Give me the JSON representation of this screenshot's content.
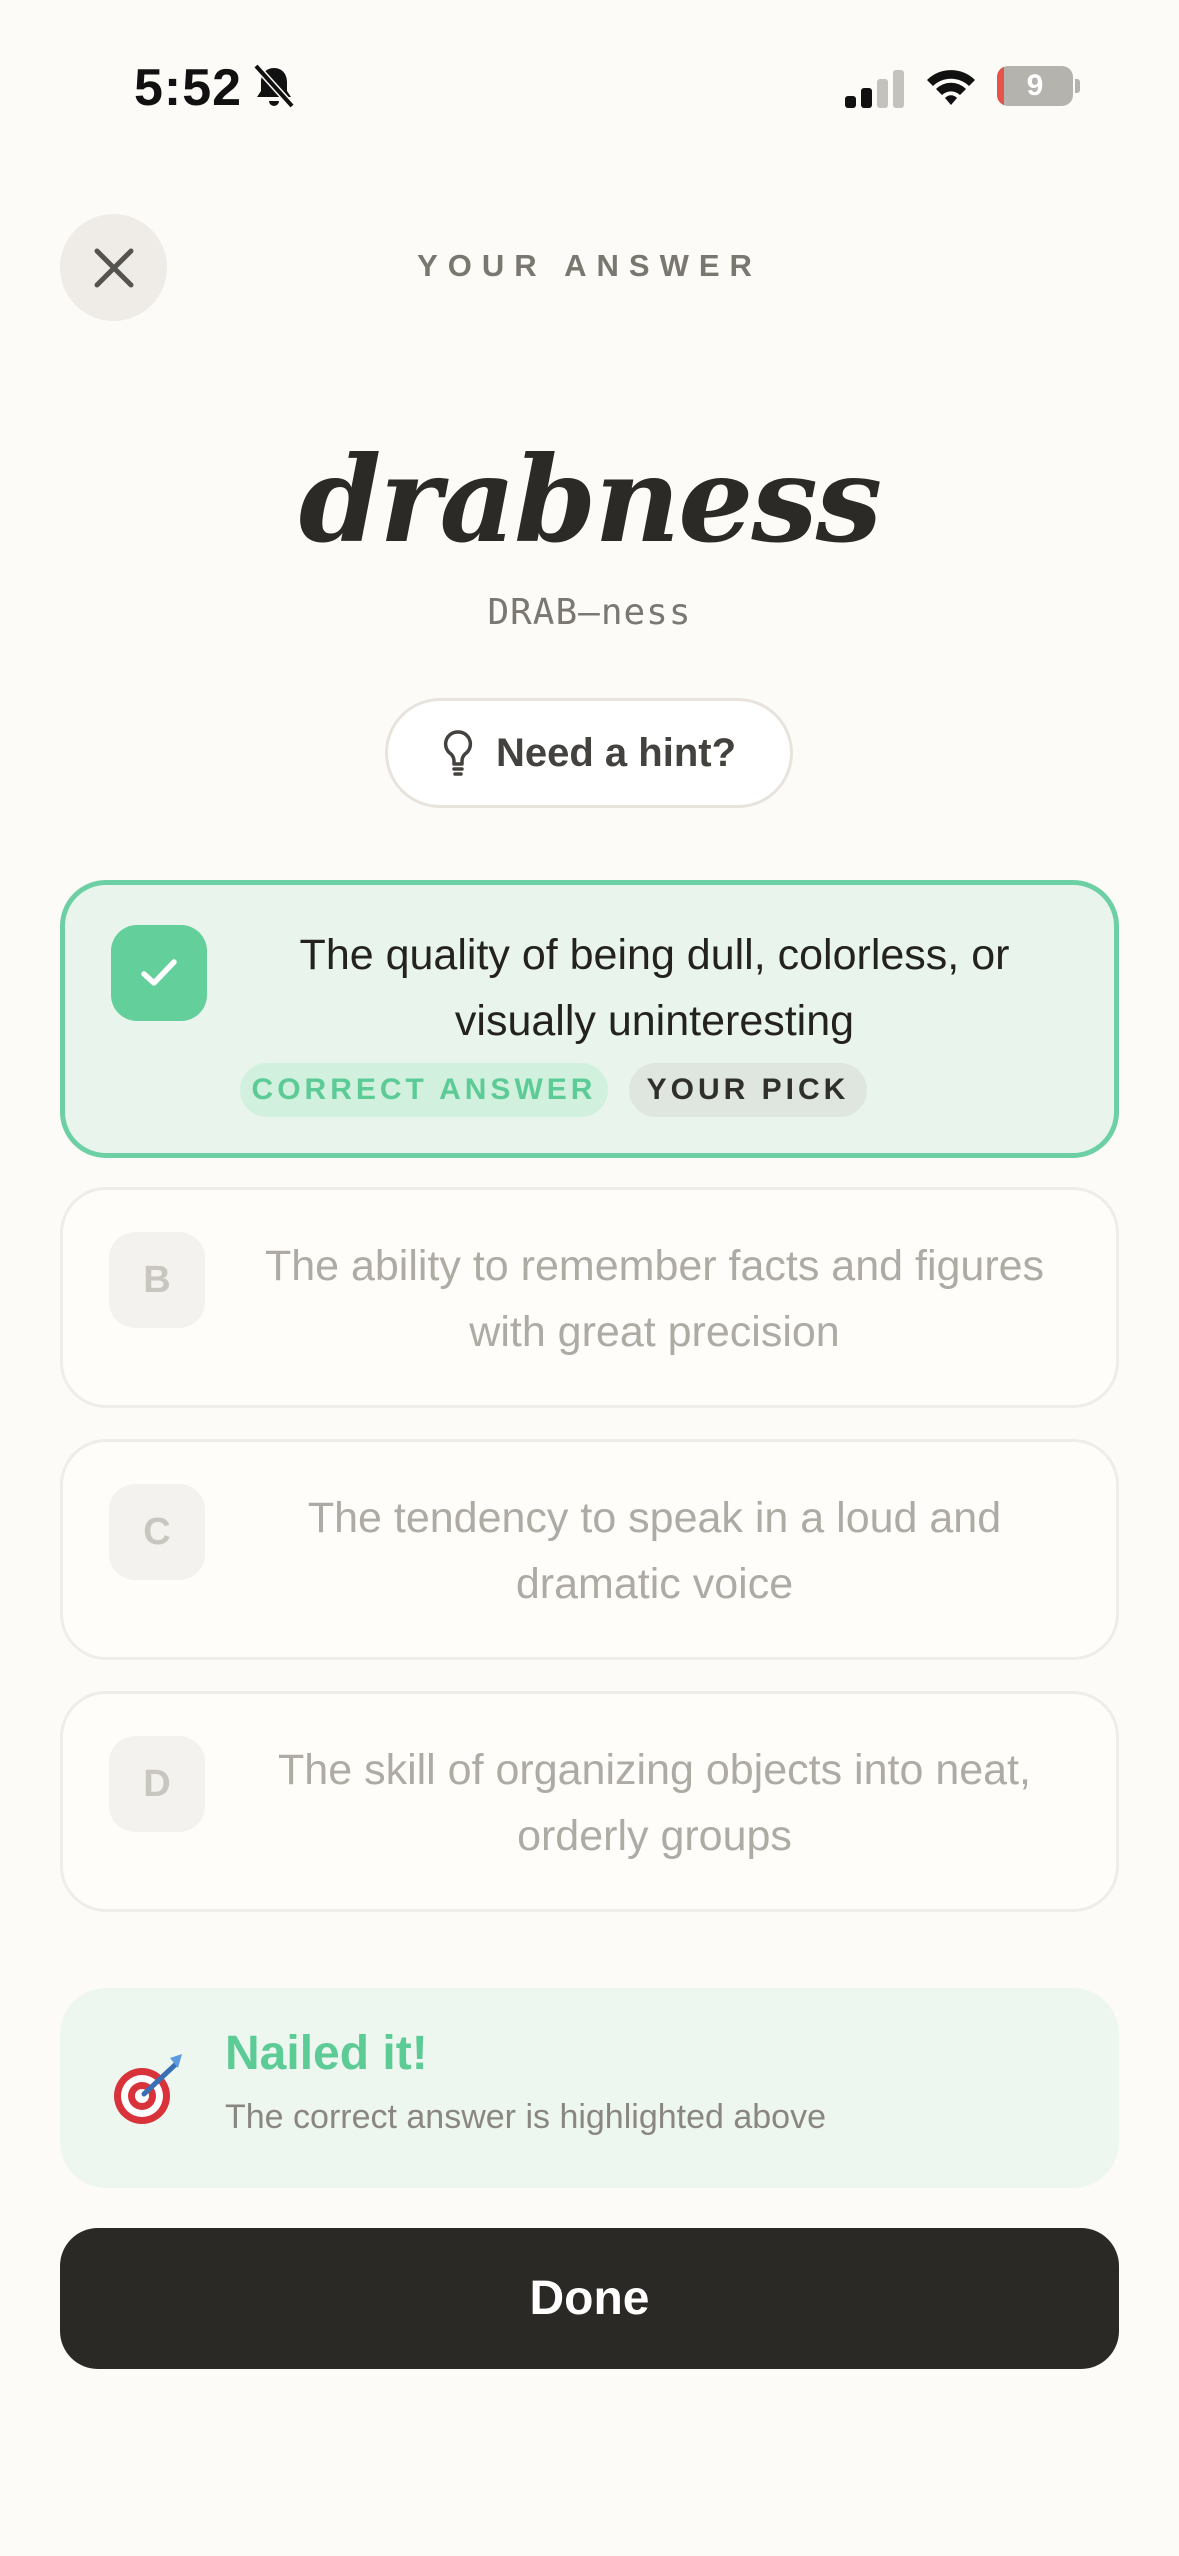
{
  "status_bar": {
    "time": "5:52",
    "battery_level": "9"
  },
  "header": {
    "screen_label": "YOUR ANSWER"
  },
  "word": {
    "term": "drabness",
    "pronunciation": "DRAB–ness"
  },
  "hint": {
    "label": "Need a hint?"
  },
  "options": [
    {
      "letter": "A",
      "text": "The quality of being dull, colorless, or visually uninteresting",
      "state": "correct-selected"
    },
    {
      "letter": "B",
      "text": "The ability to remember facts and figures with great precision",
      "state": "muted"
    },
    {
      "letter": "C",
      "text": "The tendency to speak in a loud and dramatic voice",
      "state": "muted"
    },
    {
      "letter": "D",
      "text": "The skill of organizing objects into neat, orderly groups",
      "state": "muted"
    }
  ],
  "tags": {
    "correct": "CORRECT ANSWER",
    "pick": "YOUR PICK"
  },
  "feedback": {
    "title": "Nailed it!",
    "subtitle": "The correct answer is highlighted above",
    "icon": "target-icon"
  },
  "done_label": "Done",
  "colors": {
    "accent_green": "#5ccb96",
    "correct_border": "#6dd0a4",
    "correct_bg": "#e9f5ec",
    "dark_button": "#2a2926",
    "background": "#fdfbf7"
  }
}
